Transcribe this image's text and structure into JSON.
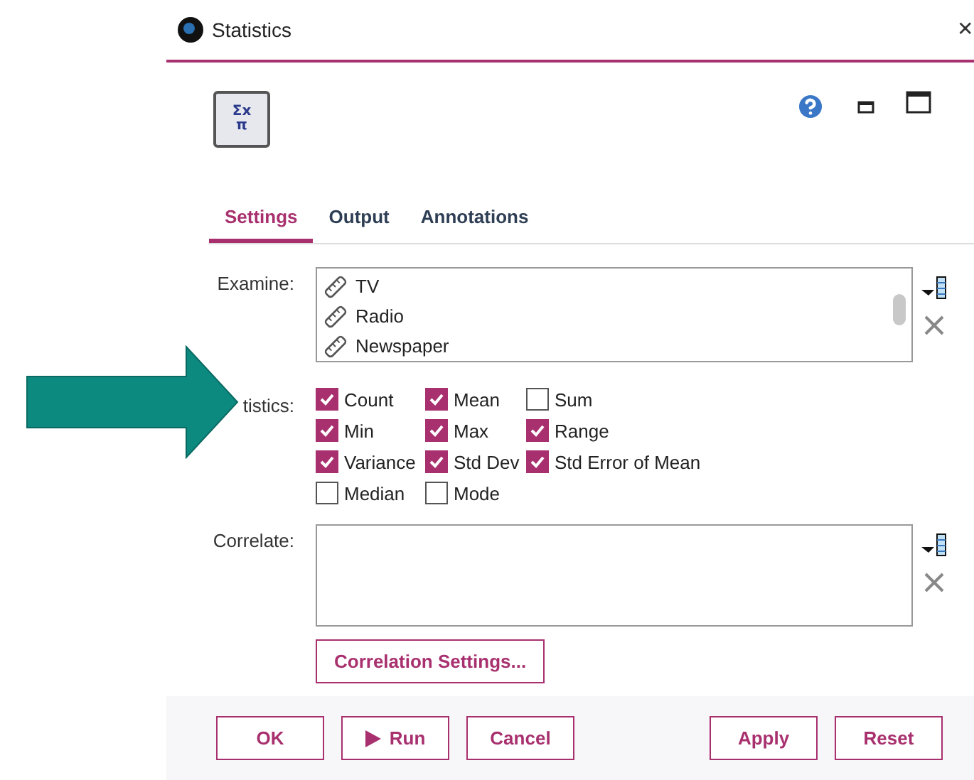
{
  "window": {
    "title": "Statistics",
    "close": "✕"
  },
  "node_icon": {
    "symbol": "Σx",
    "sub": "π"
  },
  "tabs": [
    {
      "label": "Settings",
      "selected": true
    },
    {
      "label": "Output",
      "selected": false
    },
    {
      "label": "Annotations",
      "selected": false
    }
  ],
  "examine": {
    "label": "Examine:",
    "items": [
      "TV",
      "Radio",
      "Newspaper"
    ]
  },
  "statistics": {
    "label": "tistics:",
    "options": [
      {
        "label": "Count",
        "checked": true
      },
      {
        "label": "Mean",
        "checked": true
      },
      {
        "label": "Sum",
        "checked": false
      },
      {
        "label": "Min",
        "checked": true
      },
      {
        "label": "Max",
        "checked": true
      },
      {
        "label": "Range",
        "checked": true
      },
      {
        "label": "Variance",
        "checked": true
      },
      {
        "label": "Std Dev",
        "checked": true
      },
      {
        "label": "Std Error of Mean",
        "checked": true
      },
      {
        "label": "Median",
        "checked": false
      },
      {
        "label": "Mode",
        "checked": false
      }
    ]
  },
  "correlate": {
    "label": "Correlate:",
    "button": "Correlation Settings..."
  },
  "footer": {
    "left": [
      {
        "label": "OK",
        "kind": "plain"
      },
      {
        "label": "Run",
        "kind": "play"
      },
      {
        "label": "Cancel",
        "kind": "plain"
      }
    ],
    "right": [
      {
        "label": "Apply",
        "kind": "plain"
      },
      {
        "label": "Reset",
        "kind": "plain"
      }
    ]
  }
}
